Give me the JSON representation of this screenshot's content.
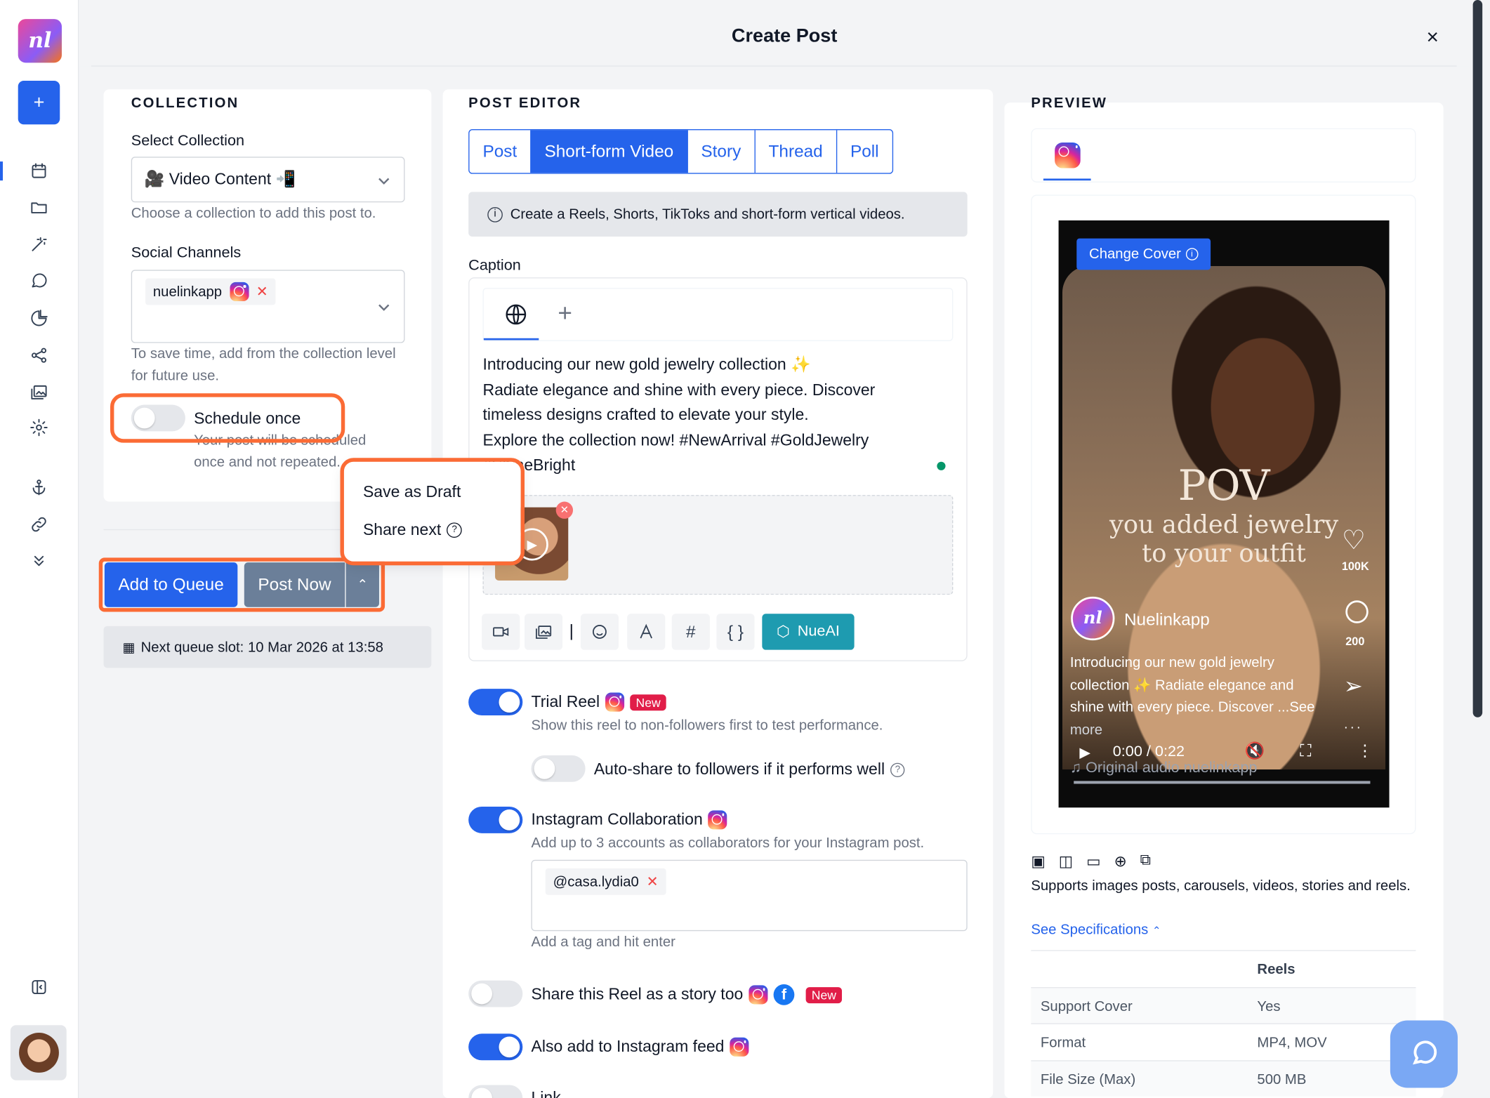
{
  "header": {
    "title": "Create Post",
    "close": "×"
  },
  "sidebar": {
    "logo": "nl",
    "add": "+"
  },
  "collection": {
    "section": "COLLECTION",
    "select_label": "Select Collection",
    "selected": "🎥 Video Content 📲",
    "select_hint": "Choose a collection to add this post to.",
    "channels_label": "Social Channels",
    "channel_chip": "nuelinkapp",
    "channel_hint": "To save time, add from the collection level for future use.",
    "schedule_once": "Schedule once",
    "schedule_hint": "Your post will be scheduled once and not repeated."
  },
  "actions": {
    "add_to_queue": "Add to Queue",
    "post_now": "Post Now",
    "next_slot": "Next queue slot: 10 Mar 2026 at 13:58",
    "menu": [
      "Save as Draft",
      "Share next"
    ]
  },
  "editor": {
    "section": "POST EDITOR",
    "tabs": [
      "Post",
      "Short-form Video",
      "Story",
      "Thread",
      "Poll"
    ],
    "active_tab": "Short-form Video",
    "info": "Create a Reels, Shorts, TikToks and short-form vertical videos.",
    "caption_label": "Caption",
    "caption_lines": [
      "Introducing our new gold jewelry collection ✨",
      "Radiate elegance and shine with every piece. Discover",
      "timeless designs crafted to elevate your style.",
      "Explore the collection now! #NewArrival #GoldJewelry",
      "#ShineBright"
    ],
    "nueai": "NueAI",
    "trial_reel": "Trial Reel",
    "new_badge": "New",
    "trial_hint": "Show this reel to non-followers first to test performance.",
    "auto_share": "Auto-share to followers if it performs well",
    "collab": "Instagram Collaboration",
    "collab_hint": "Add up to 3 accounts as collaborators for your Instagram post.",
    "collab_chip": "@casa.lydia0",
    "tag_hint": "Add a tag and hit enter",
    "share_story": "Share this Reel as a story too",
    "add_feed": "Also add to Instagram feed",
    "link": "Link"
  },
  "preview": {
    "section": "PREVIEW",
    "change_cover": "Change Cover",
    "pov": "POV",
    "pov_line1": "you added jewelry",
    "pov_line2": "to your outfit",
    "account": "Nuelinkapp",
    "likes": "100K",
    "comments": "200",
    "overlay_lines": [
      "Introducing our new gold jewelry",
      "collection ✨ Radiate elegance and",
      "shine with every piece. Discover ...See",
      "more"
    ],
    "time": "0:00 / 0:22",
    "audio": "Original audio nuelinkapp",
    "supports": "Supports images posts, carousels, videos, stories and reels.",
    "see_specs": "See Specifications",
    "spec_header": "Reels",
    "specs": [
      {
        "k": "Support Cover",
        "v": "Yes"
      },
      {
        "k": "Format",
        "v": "MP4, MOV"
      },
      {
        "k": "File Size (Max)",
        "v": "500 MB"
      }
    ]
  },
  "colors": {
    "accent": "#2563eb",
    "highlight": "#fb6b35",
    "nueai": "#1e9bb0"
  }
}
